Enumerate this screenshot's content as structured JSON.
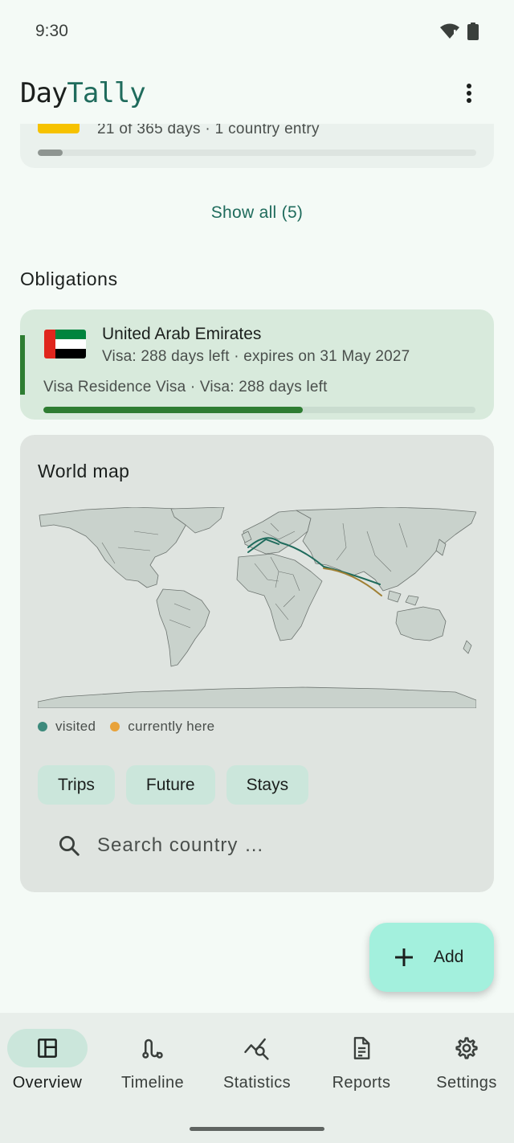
{
  "status_bar": {
    "time": "9:30"
  },
  "app_bar": {
    "title_part1": "Day",
    "title_part2": "Tally"
  },
  "prev_card": {
    "subtitle": "21 of 365 days · 1 country entry",
    "count": "21",
    "progress": 0.057
  },
  "show_all_label": "Show all (5)",
  "obligations": {
    "title": "Obligations",
    "card": {
      "country": "United Arab Emirates",
      "subtitle": "Visa: 288 days left · expires on 31 May 2027",
      "detail": "Visa Residence Visa · Visa: 288 days left",
      "progress": 0.6
    }
  },
  "world_map": {
    "title": "World map",
    "legend": [
      {
        "label": "visited",
        "color": "#3d8a7c"
      },
      {
        "label": "currently here",
        "color": "#e8a23a"
      }
    ],
    "chips": [
      "Trips",
      "Future",
      "Stays"
    ],
    "search_placeholder": "Search country …"
  },
  "fab": {
    "label": "Add"
  },
  "bottom_nav": [
    {
      "label": "Overview",
      "icon": "dashboard-icon",
      "active": true
    },
    {
      "label": "Timeline",
      "icon": "route-icon",
      "active": false
    },
    {
      "label": "Statistics",
      "icon": "query-stats-icon",
      "active": false
    },
    {
      "label": "Reports",
      "icon": "document-icon",
      "active": false
    },
    {
      "label": "Settings",
      "icon": "gear-icon",
      "active": false
    }
  ],
  "colors": {
    "accent": "#1f6b5c",
    "route_visited": "#1f6b5c",
    "route_current": "#a08035",
    "progress": "#2e7d32"
  }
}
